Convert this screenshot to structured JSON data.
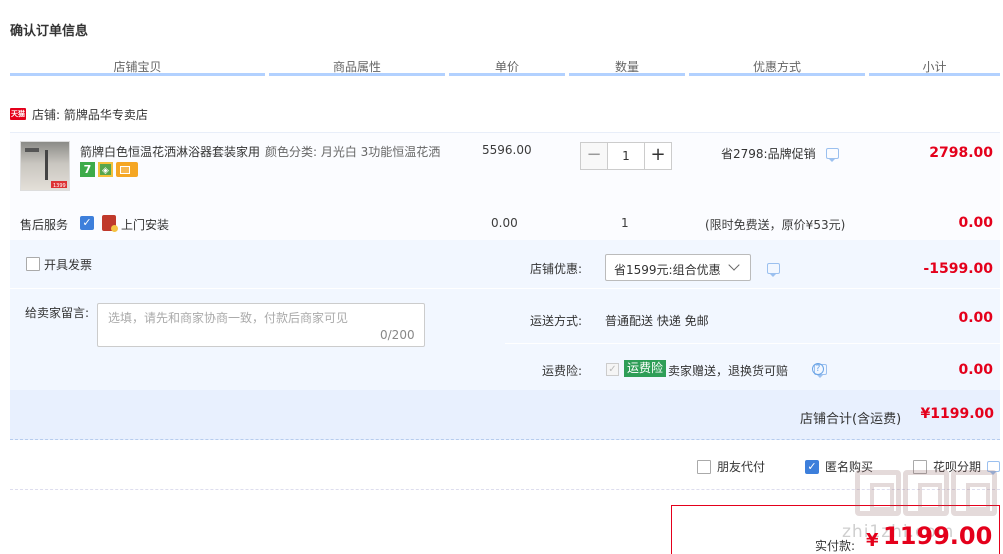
{
  "page": {
    "title": "确认订单信息"
  },
  "table_headers": [
    "店铺宝贝",
    "商品属性",
    "单价",
    "数量",
    "优惠方式",
    "小计"
  ],
  "shop": {
    "badge": "天猫",
    "label": "店铺: 箭牌品华专卖店"
  },
  "item": {
    "name": "箭牌白色恒温花洒淋浴器套装家用",
    "property": "颜色分类: 月光白 3功能恒温花洒",
    "unit_price": "5596.00",
    "quantity": "1",
    "qty_minus": "−",
    "qty_plus": "+",
    "promo": "省2798:品牌促销",
    "subtotal": "2798.00",
    "badge_7": "7",
    "thumb_price": "1399"
  },
  "service": {
    "label": "售后服务",
    "name": "上门安装",
    "checked_mark": "✓",
    "price": "0.00",
    "quantity": "1",
    "note": "(限时免费送，原价¥53元)",
    "subtotal": "0.00"
  },
  "invoice": {
    "label": "开具发票"
  },
  "message": {
    "label": "给卖家留言:",
    "placeholder": "选填，请先和商家协商一致，付款后商家可见",
    "count": "0/200"
  },
  "shop_discount": {
    "label": "店铺优惠:",
    "selected": "省1599元:组合优惠",
    "amount": "-1599.00"
  },
  "shipping": {
    "label": "运送方式:",
    "value": "普通配送 快递 免邮",
    "amount": "0.00"
  },
  "insurance": {
    "label": "运费险:",
    "badge": "运费险",
    "desc": "卖家赠送，退换货可赔",
    "amount": "0.00",
    "check_mark": "✓",
    "help": "?"
  },
  "shop_total": {
    "label": "店铺合计(含运费)",
    "value": "¥1199.00"
  },
  "options": [
    {
      "label": "朋友代付",
      "checked": false
    },
    {
      "label": "匿名购买",
      "checked": true
    },
    {
      "label": "花呗分期",
      "checked": false
    }
  ],
  "payment": {
    "label": "实付款:",
    "currency": "¥",
    "value": "1199.00"
  },
  "watermark": {
    "text": "zhi1zhi.com"
  }
}
